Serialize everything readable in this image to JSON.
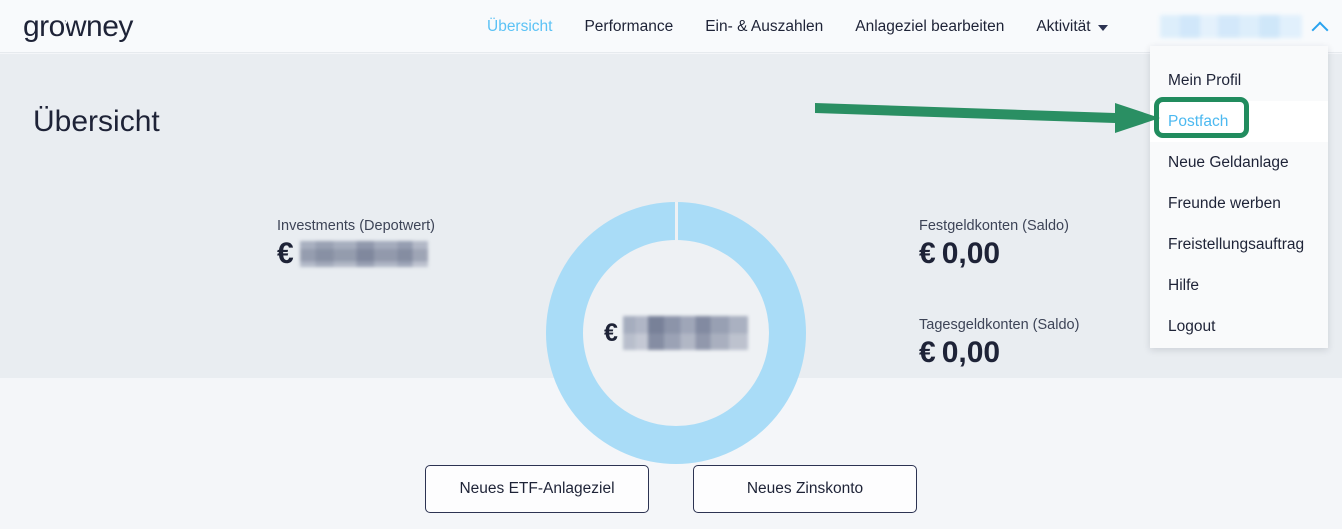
{
  "brand": {
    "logo_part1": "gro",
    "logo_w": "w",
    "logo_part2": "ney",
    "logo_full": "growney",
    "navy": "#1e2337",
    "accent_blue": "#5bc2f5",
    "donut_blue": "#a9dcf7",
    "annotation_green": "#218c5e"
  },
  "nav": {
    "items": [
      {
        "label": "Übersicht",
        "active": true
      },
      {
        "label": "Performance",
        "active": false
      },
      {
        "label": "Ein- & Auszahlen",
        "active": false
      },
      {
        "label": "Anlageziel bearbeiten",
        "active": false
      },
      {
        "label": "Aktivität",
        "active": false,
        "caret": "chevron-down-icon"
      }
    ]
  },
  "user_menu": {
    "username": "",
    "username_redacted": true,
    "toggle_icon": "chevron-up-icon",
    "open": true,
    "items": [
      {
        "label": "Mein Profil",
        "hovered": false
      },
      {
        "label": "Postfach",
        "hovered": true
      },
      {
        "label": "Neue Geldanlage",
        "hovered": false
      },
      {
        "label": "Freunde werben",
        "hovered": false
      },
      {
        "label": "Freistellungsauftrag",
        "hovered": false
      },
      {
        "label": "Hilfe",
        "hovered": false
      },
      {
        "label": "Logout",
        "hovered": false
      }
    ]
  },
  "page": {
    "title": "Übersicht"
  },
  "stats": {
    "investments": {
      "label": "Investments (Depotwert)",
      "currency": "€",
      "value": "",
      "redacted": true
    },
    "festgeld": {
      "label": "Festgeldkonten (Saldo)",
      "currency": "€",
      "value": "0,00"
    },
    "tagesgeld": {
      "label": "Tagesgeldkonten (Saldo)",
      "currency": "€",
      "value": "0,00"
    }
  },
  "donut": {
    "currency": "€",
    "center_value": "",
    "center_redacted": true
  },
  "chart_data": {
    "type": "pie",
    "title": "",
    "categories": [
      "Investments (Depotwert)"
    ],
    "values": [
      100
    ],
    "colors": [
      "#a9dcf7"
    ],
    "donut": true,
    "inner_radius_ratio": 0.715,
    "legend": "none",
    "center_label": "€ (redacted)"
  },
  "actions": {
    "buttons": [
      {
        "label": "Neues ETF-Anlageziel"
      },
      {
        "label": "Neues Zinskonto"
      }
    ]
  },
  "annotations": {
    "arrow": {
      "type": "arrow-right",
      "color": "#218c5e",
      "points_to": "Postfach"
    },
    "highlight": {
      "type": "rounded-rect",
      "color": "#218c5e",
      "target": "Postfach"
    }
  }
}
